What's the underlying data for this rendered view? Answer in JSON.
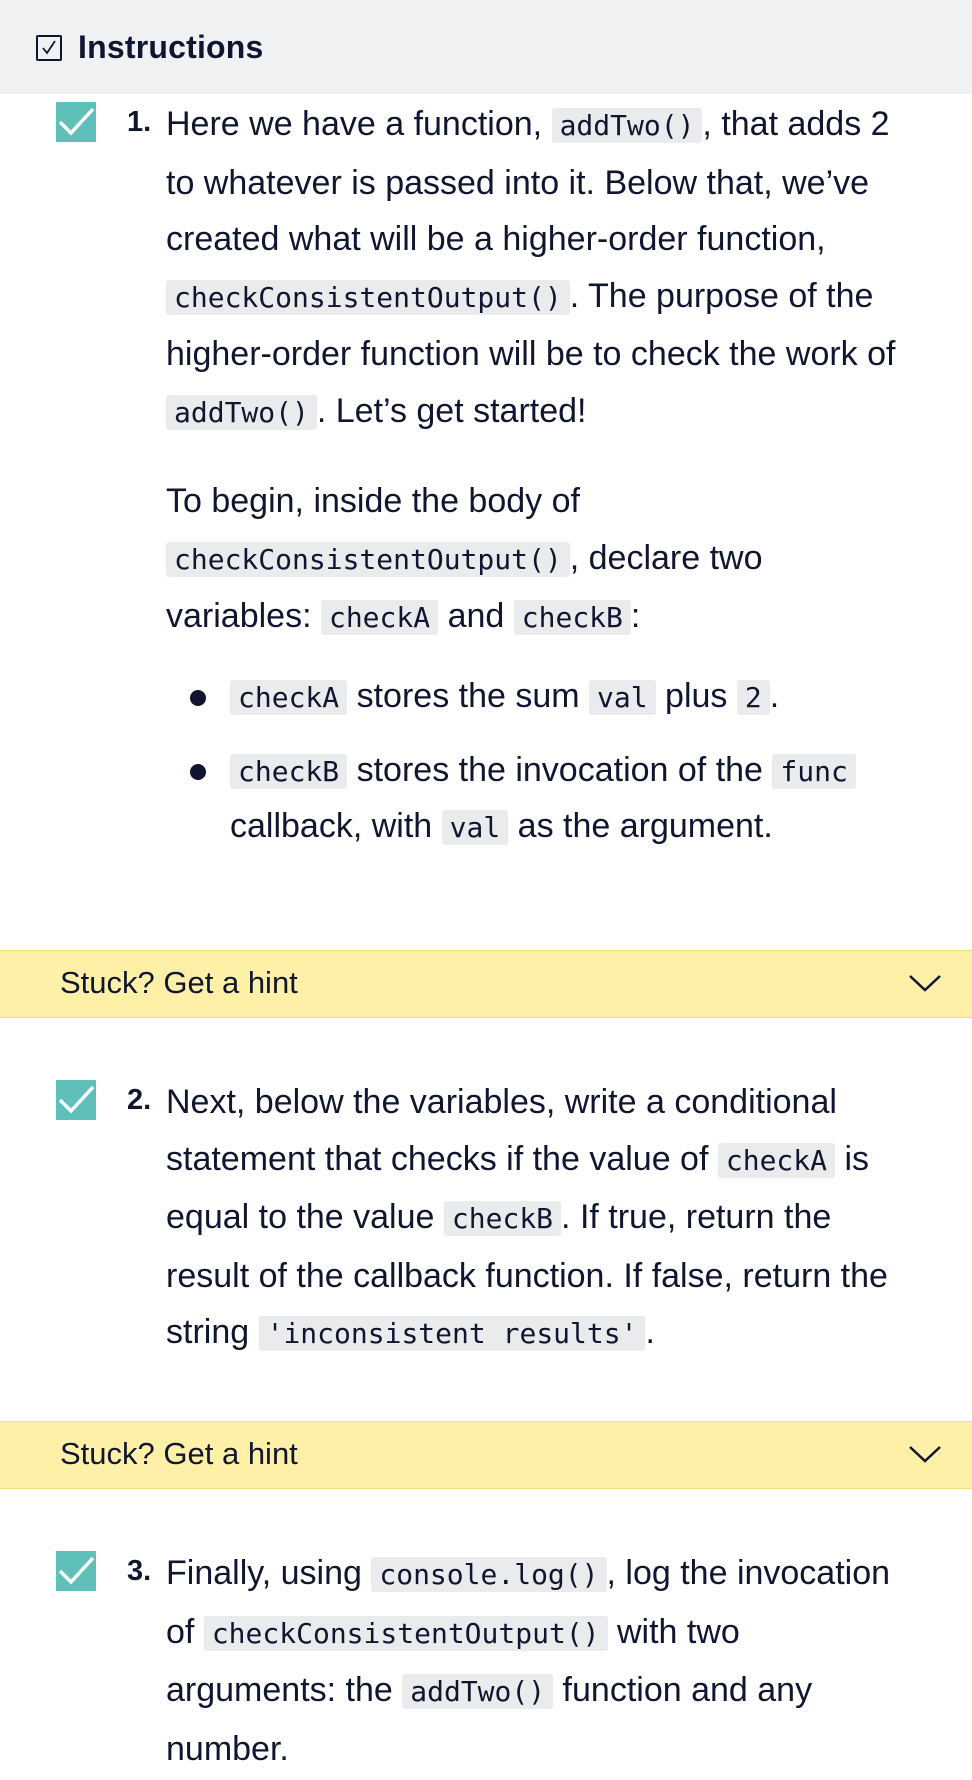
{
  "header": {
    "title": "Instructions",
    "icon": "checkbox-icon"
  },
  "colors": {
    "header_bg": "#f0f1f2",
    "check_bg": "#5fc0b9",
    "hint_bg": "#fff0a8",
    "code_bg": "#eaebed",
    "text": "#10162f"
  },
  "tasks": [
    {
      "number": "1.",
      "completed": true,
      "p1": {
        "t0": "Here we have a function, ",
        "c0": "addTwo()",
        "t1": ", that adds 2 to whatever is passed into it. Below that, we’ve created what will be a higher-order function, ",
        "c1": "checkConsistentOutput()",
        "t2": ". The purpose of the higher-order function will be to check the work of ",
        "c2": "addTwo()",
        "t3": ". Let’s get started!"
      },
      "p2": {
        "t0": "To begin, inside the body of ",
        "c0": "checkConsistentOutput()",
        "t1": ", declare two variables: ",
        "c1": "checkA",
        "t2": " and ",
        "c2": "checkB",
        "t3": ":"
      },
      "bullets": [
        {
          "c0": "checkA",
          "t0": " stores the sum ",
          "c1": "val",
          "t1": " plus ",
          "c2": "2",
          "t2": "."
        },
        {
          "c0": "checkB",
          "t0": " stores the invocation of the ",
          "c1": "func",
          "t1": " callback, with ",
          "c2": "val",
          "t2": " as the argument."
        }
      ]
    },
    {
      "number": "2.",
      "completed": true,
      "p1": {
        "t0": "Next, below the variables, write a conditional statement that checks if the value of ",
        "c0": "checkA",
        "t1": " is equal to the value ",
        "c1": "checkB",
        "t2": ". If true, return the result of the callback function. If false, return the string ",
        "c2": "'inconsistent results'",
        "t3": "."
      }
    },
    {
      "number": "3.",
      "completed": true,
      "p1": {
        "t0": "Finally, using ",
        "c0": "console.log()",
        "t1": ", log the invocation of ",
        "c1": "checkConsistentOutput()",
        "t2": " with two arguments: the ",
        "c2": "addTwo()",
        "t3": " function and any number."
      }
    }
  ],
  "hints": [
    {
      "label": "Stuck? Get a hint",
      "icon": "chevron-down-icon"
    },
    {
      "label": "Stuck? Get a hint",
      "icon": "chevron-down-icon"
    }
  ]
}
